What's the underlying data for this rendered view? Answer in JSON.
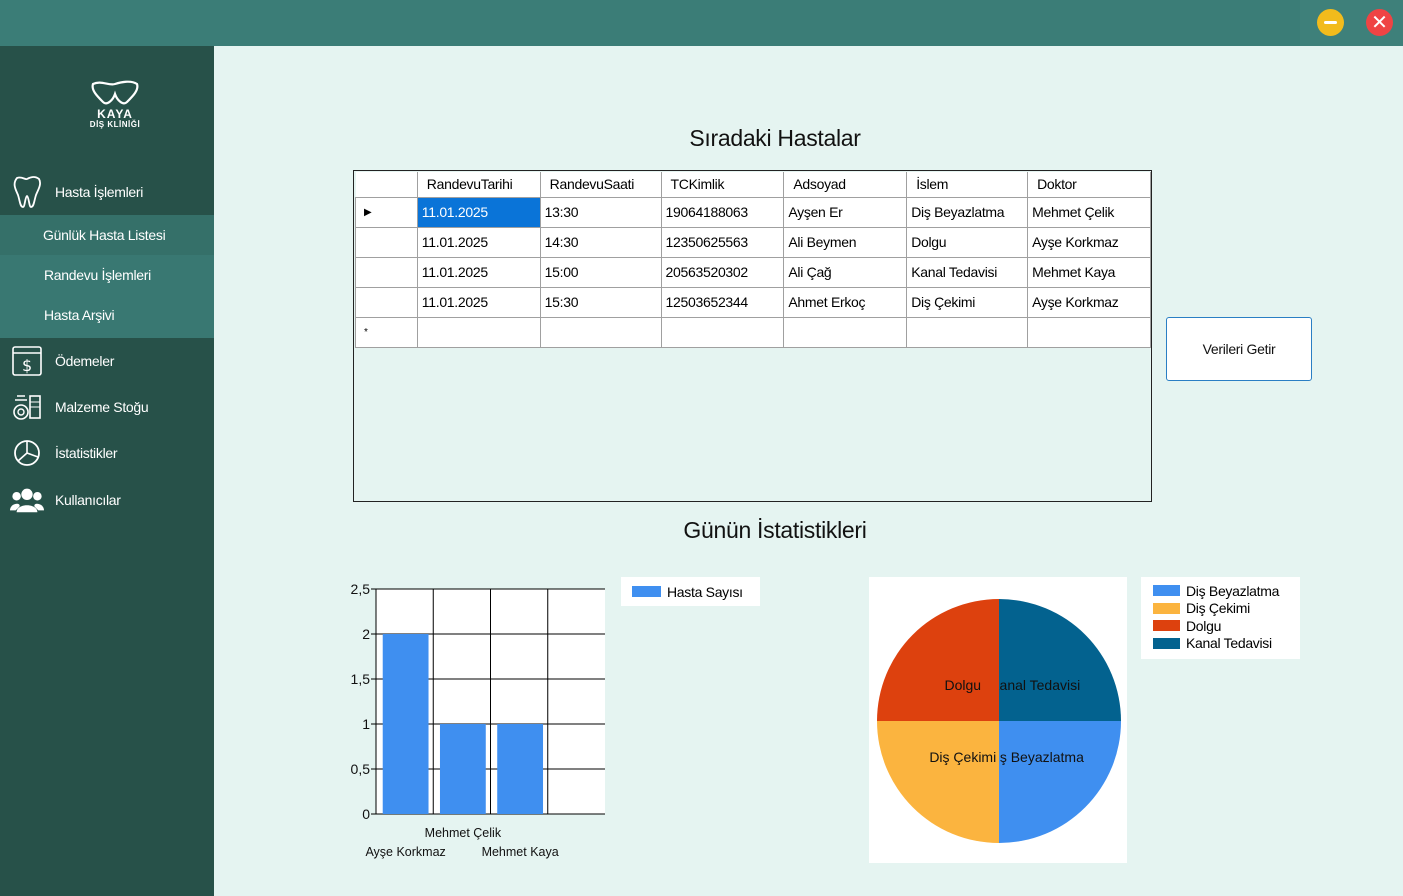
{
  "window": {
    "close_glyph": "✕"
  },
  "logo": {
    "line1": "KAYA",
    "line2": "DİŞ KLİNİĞİ"
  },
  "sidebar": {
    "hasta_islemleri": "Hasta İşlemleri",
    "submenu": [
      "Günlük Hasta Listesi",
      "Randevu İşlemleri",
      "Hasta Arşivi"
    ],
    "odemeler": "Ödemeler",
    "malzeme": "Malzeme Stoğu",
    "istatistikler": "İstatistikler",
    "kullanicilar": "Kullanıcılar"
  },
  "main": {
    "title": "Sıradaki Hastalar",
    "stats_title": "Günün İstatistikleri",
    "button": "Verileri Getir"
  },
  "table": {
    "columns": [
      "RandevuTarihi",
      "RandevuSaati",
      "TCKimlik",
      "Adsoyad",
      "İslem",
      "Doktor"
    ],
    "current_marker": "▶",
    "new_row_marker": "*",
    "rows": [
      [
        "11.01.2025",
        "13:30",
        "19064188063",
        "Ayşen Er",
        "Diş Beyazlatma",
        "Mehmet Çelik"
      ],
      [
        "11.01.2025",
        "14:30",
        "12350625563",
        "Ali Beymen",
        "Dolgu",
        "Ayşe Korkmaz"
      ],
      [
        "11.01.2025",
        "15:00",
        "20563520302",
        "Ali Çağ",
        "Kanal Tedavisi",
        "Mehmet Kaya"
      ],
      [
        "11.01.2025",
        "15:30",
        "12503652344",
        "Ahmet Erkoç",
        "Diş Çekimi",
        "Ayşe Korkmaz"
      ]
    ]
  },
  "colors": {
    "sidebar": "#275149",
    "topbar": "#3b7d77",
    "selection": "#0a74d8",
    "bar": "#3f8ff0"
  },
  "chart_data": [
    {
      "type": "bar",
      "categories": [
        "Ayşe Korkmaz",
        "Mehmet Çelik",
        "Mehmet Kaya"
      ],
      "series": [
        {
          "name": "Hasta Sayısı",
          "values": [
            2,
            1,
            1
          ]
        }
      ],
      "ylim": [
        0,
        2.5
      ],
      "yticks": [
        "0",
        "0,5",
        "1",
        "1,5",
        "2",
        "2,5"
      ],
      "grid": true,
      "legend": "right"
    },
    {
      "type": "pie",
      "slices": [
        {
          "label": "Diş Beyazlatma",
          "value": 1,
          "color": "#3f8ff0"
        },
        {
          "label": "Diş Çekimi",
          "value": 1,
          "color": "#fbb43f"
        },
        {
          "label": "Dolgu",
          "value": 1,
          "color": "#dd410e"
        },
        {
          "label": "Kanal Tedavisi",
          "value": 1,
          "color": "#03628f"
        }
      ],
      "legend": "right"
    }
  ]
}
